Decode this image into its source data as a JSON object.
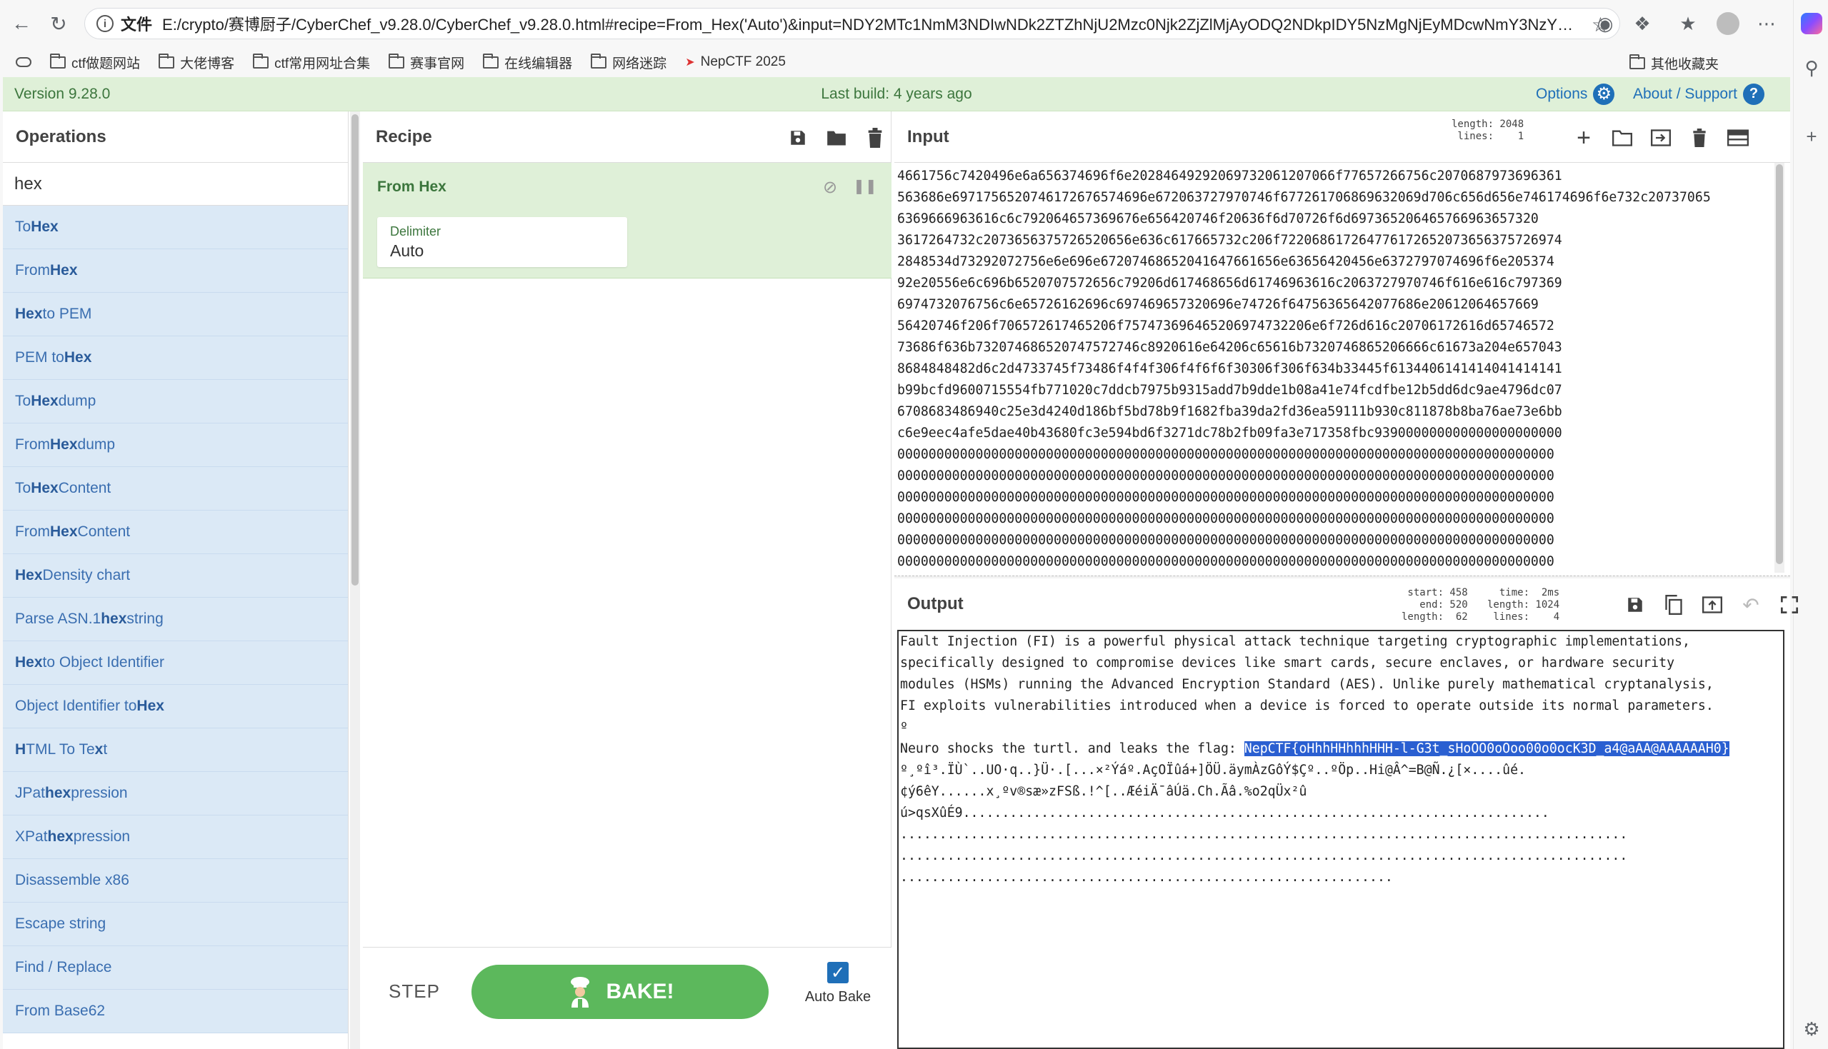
{
  "browser": {
    "file_label": "文件",
    "url": "E:/crypto/赛博厨子/CyberChef_v9.28.0/CyberChef_v9.28.0.html#recipe=From_Hex('Auto')&input=NDY2MTc1NmM3NDIwNDk2ZTZhNjU2Mzc0Njk2ZjZlMjAyODQ2NDkpIDY5NzMgNjEyMDcwNmY3NzY1NzI2NjU1NmMgNzA2ODc5NzNmY1NzY1Nzl...",
    "bookmarks": [
      "ctf做题网站",
      "大佬博客",
      "ctf常用网址合集",
      "赛事官网",
      "在线编辑器",
      "网络迷踪",
      "NepCTF 2025"
    ],
    "bookmarks_other": "其他收藏夹"
  },
  "banner": {
    "version": "Version 9.28.0",
    "build": "Last build: 4 years ago",
    "options": "Options",
    "about": "About / Support"
  },
  "operations": {
    "title": "Operations",
    "search_value": "hex",
    "items": [
      {
        "pre": "To ",
        "hl": "Hex",
        "post": ""
      },
      {
        "pre": "From ",
        "hl": "Hex",
        "post": ""
      },
      {
        "pre": "",
        "hl": "Hex",
        "post": " to PEM"
      },
      {
        "pre": "PEM to ",
        "hl": "Hex",
        "post": ""
      },
      {
        "pre": "To ",
        "hl": "Hex",
        "post": "dump"
      },
      {
        "pre": "From ",
        "hl": "Hex",
        "post": "dump"
      },
      {
        "pre": "To ",
        "hl": "Hex",
        "post": " Content"
      },
      {
        "pre": "From ",
        "hl": "Hex",
        "post": " Content"
      },
      {
        "pre": "",
        "hl": "Hex",
        "post": " Density chart"
      },
      {
        "pre": "Parse ASN.1 ",
        "hl": "hex",
        "post": " string"
      },
      {
        "pre": "",
        "hl": "Hex",
        "post": " to Object Identifier"
      },
      {
        "pre": "Object Identifier to ",
        "hl": "Hex",
        "post": ""
      },
      {
        "pre": "",
        "hl": "H",
        "post": "TML To Te",
        "hl2": "x",
        "post2": "t"
      },
      {
        "pre": "JPat",
        "hl": "h",
        "post": " ",
        "hl2": "ex",
        "post2": "pression"
      },
      {
        "pre": "XPat",
        "hl": "h",
        "post": " ",
        "hl2": "ex",
        "post2": "pression"
      },
      {
        "pre": "Disassemble x86",
        "hl": "",
        "post": ""
      },
      {
        "pre": "Escape string",
        "hl": "",
        "post": ""
      },
      {
        "pre": "Find / Replace",
        "hl": "",
        "post": ""
      },
      {
        "pre": "From Base62",
        "hl": "",
        "post": ""
      }
    ]
  },
  "recipe": {
    "title": "Recipe",
    "operation": "From Hex",
    "delimiter_label": "Delimiter",
    "delimiter_value": "Auto",
    "step": "STEP",
    "bake": "BAKE!",
    "auto_bake": "Auto Bake"
  },
  "input": {
    "title": "Input",
    "stats": "length: 2048\n lines:    1",
    "lines": [
      "4661756c7420496e6a656374696f6e20284649292069732061207066f77657266756c2070687973696361",
      "563686e6971756520746172676574696e672063727970746f677261706869632069d706c656d656e746174696f6e732c20737065",
      "6369666963616c6c792064657369676e656420746f20636f6d70726f6d697365206465766963657320",
      "3617264732c2073656375726520656e636c617665732c206f722068617264776172652073656375726974",
      "2848534d73292072756e6e696e67207468652041647661656e63656420456e6372797074696f6e205374",
      "92e20556e6c696b6520707572656c79206d617468656d61746963616c2063727970746f616e616c797369",
      "6974732076756c6e65726162696c697469657320696e74726f64756365642077686e20612064657669",
      "56420746f206f706572617465206f757473696465206974732206e6f726d616c20706172616d65746572",
      "73686f636b732074686520747572746c8920616e64206c65616b7320746865206666c61673a204e657043",
      "8684848482d6c2d4733745f73486f4f4f306f4f6f6f30306f306f634b33445f6134406141414041414141",
      "b99bcfd9600715554fb771020c7ddcb7975b9315add7b9dde1b08a41e74fcdfbe12b5dd6dc9ae4796dc07",
      "6708683486940c25e3d4240d186bf5bd78b9f1682fba39da2fd36ea59111b930c811878b8ba76ae73e6bb",
      "c6e9eec4afe5dae40b43680fc3e594bd6f3271dc78b2fb09fa3e717358fbc939000000000000000000000",
      "000000000000000000000000000000000000000000000000000000000000000000000000000000000000",
      "000000000000000000000000000000000000000000000000000000000000000000000000000000000000",
      "000000000000000000000000000000000000000000000000000000000000000000000000000000000000",
      "000000000000000000000000000000000000000000000000000000000000000000000000000000000000",
      "000000000000000000000000000000000000000000000000000000000000000000000000000000000000",
      "000000000000000000000000000000000000000000000000000000000000000000000000000000000000"
    ]
  },
  "output": {
    "title": "Output",
    "stats_left": "start: 458\n  end: 520\nlength:  62",
    "stats_right": "time:  2ms\nlength: 1024\n lines:    4",
    "line1": "Fault Injection (FI) is a powerful physical attack technique targeting cryptographic implementations,",
    "line2": "specifically designed to compromise devices like smart cards, secure enclaves, or hardware security",
    "line3": "modules (HSMs) running the Advanced Encryption Standard (AES). Unlike purely mathematical cryptanalysis,",
    "line4": "FI exploits vulnerabilities introduced when a device is forced to operate outside its normal parameters.",
    "line5": "º",
    "line6_pre": "Neuro shocks the turtl. and leaks the flag: ",
    "flag": "NepCTF{oHhhHHhhhHHH-l-G3t_sHoOO0oOoo00o0ocK3D_a4@aAA@AAAAAAH0}",
    "line7": "º¸ºî³.ÏÙ`..UO·q..}Ü·.[...×²Ýáº.AçOÏûá+]ÖÜ.äymÀzGôÝ$Çº..ºÖp..Hi@Â^=B@Ñ.¿[×....ûé.",
    "line8": "¢ý6êY......x¸ºv®sæ»zFSß.!^[..ÆéiÄ¯âÚä.Ch.Ãâ.%o2qÜx²û",
    "line9": "ú>qsXûÉ9...........................................................................",
    "line10": ".............................................................................................",
    "line11": ".............................................................................................",
    "line12": "..............................................................."
  }
}
